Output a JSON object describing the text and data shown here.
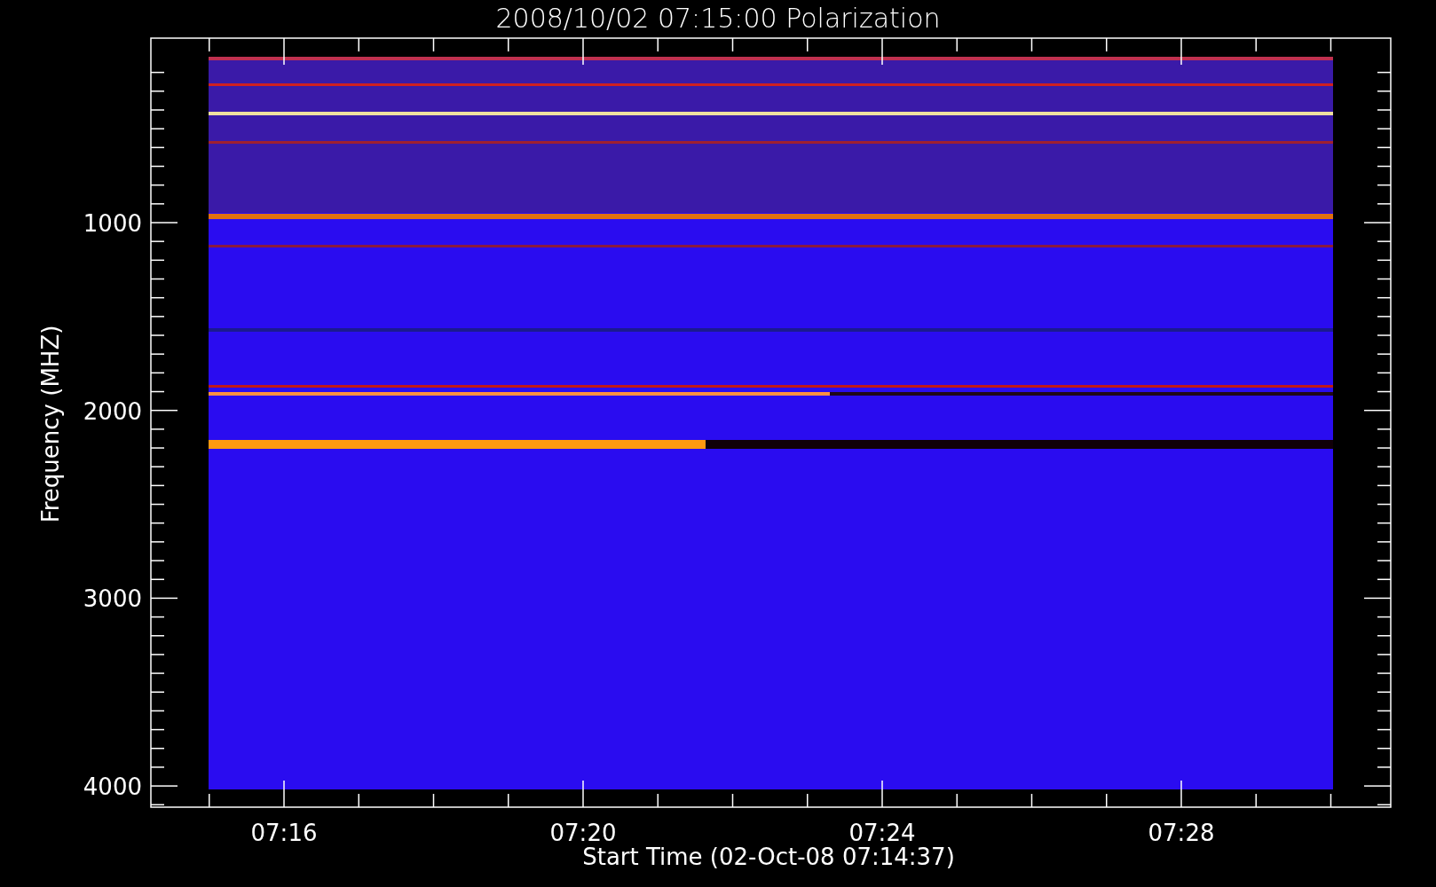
{
  "title": "2008/10/02 07:15:00 Polarization",
  "y_axis": {
    "label": "Frequency (MHZ)",
    "ticks": [
      "1000",
      "2000",
      "3000",
      "4000"
    ]
  },
  "x_axis": {
    "label": "Start Time (02-Oct-08 07:14:37)",
    "ticks": [
      "07:16",
      "07:20",
      "07:24",
      "07:28"
    ]
  }
}
